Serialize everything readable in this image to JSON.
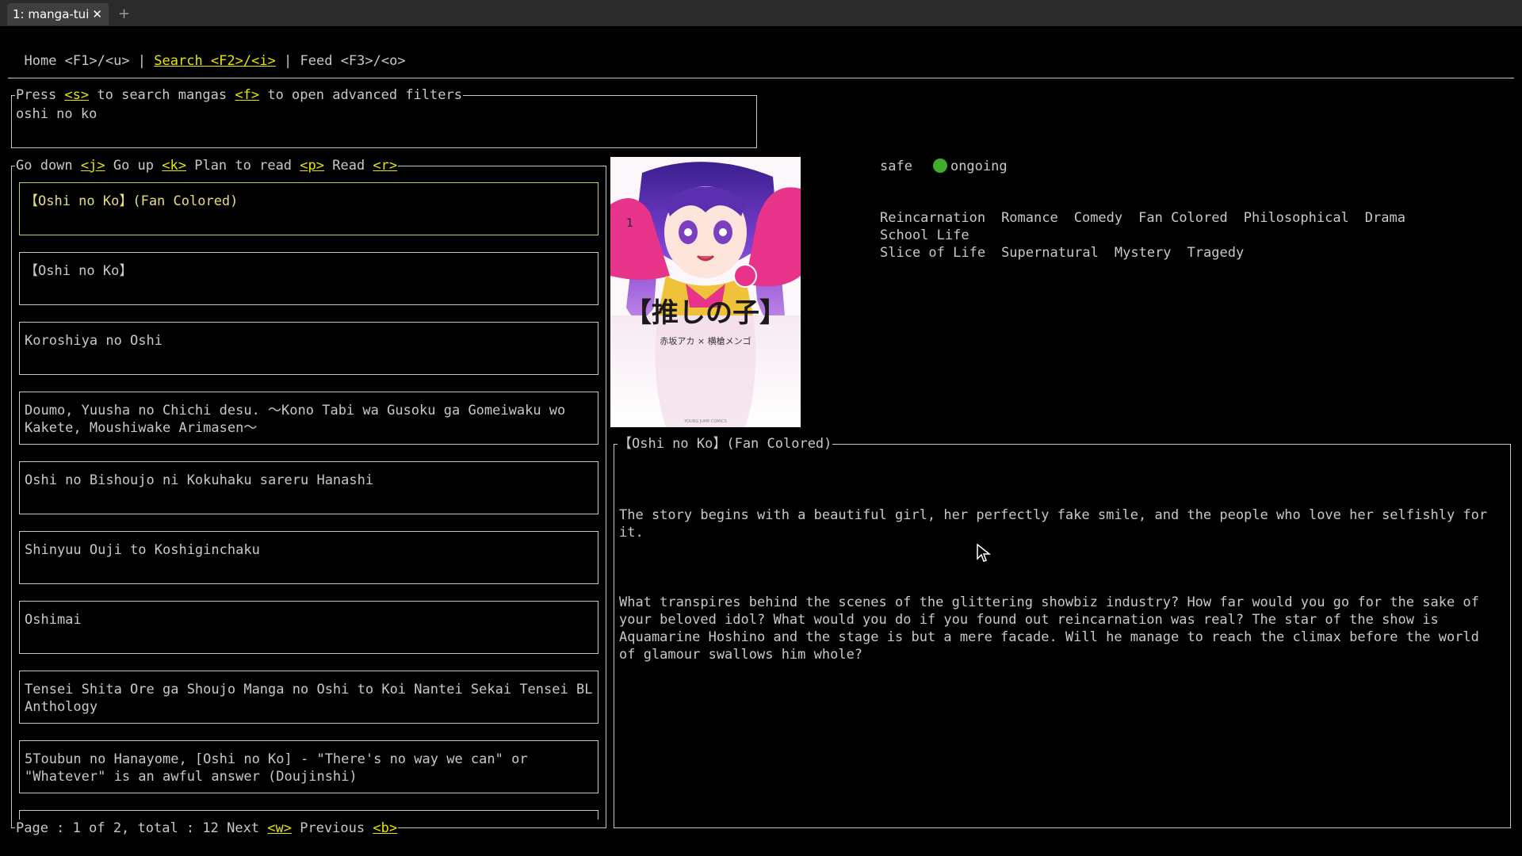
{
  "terminal": {
    "tab_title": "1: manga-tui",
    "close_glyph": "✕",
    "new_tab_glyph": "+"
  },
  "nav": {
    "home": "Home <F1>/<u>",
    "sep1": " | ",
    "search": "Search <F2>/<i>",
    "sep2": " | ",
    "feed": "Feed <F3>/<o>"
  },
  "search": {
    "hint_pre": "Press ",
    "hint_key_s": "<s>",
    "hint_mid": " to search mangas ",
    "hint_key_f": "<f>",
    "hint_post": " to open advanced filters",
    "value": "oshi no ko"
  },
  "list": {
    "help": {
      "down_label": "Go down ",
      "down_key": "<j>",
      "up_label": " Go up ",
      "up_key": "<k>",
      "plan_label": " Plan to read ",
      "plan_key": "<p>",
      "read_label": " Read ",
      "read_key": "<r>"
    },
    "items": [
      "【Oshi no Ko】(Fan Colored)",
      "【Oshi no Ko】",
      "Koroshiya no Oshi",
      "Doumo, Yuusha no Chichi desu. ～Kono Tabi wa Gusoku ga Gomeiwaku wo Kakete, Moushiwake Arimasen～",
      "Oshi no Bishoujo ni Kokuhaku sareru Hanashi",
      "Shinyuu Ouji to Koshiginchaku",
      "Oshimai",
      "Tensei Shita Ore ga Shoujo Manga no Oshi to Koi Nantei Sekai Tensei BL Anthology",
      "5Toubun no Hanayome, [Oshi no Ko] - \"There's no way we can\" or \"Whatever\" is an awful answer (Doujinshi)"
    ],
    "selected_index": 0,
    "pagination": {
      "text": "Page : 1 of 2, total : 12 Next ",
      "next_key": "<w>",
      "prev_label": " Previous ",
      "prev_key": "<b>"
    }
  },
  "details": {
    "content_rating": "safe",
    "status": "ongoing",
    "status_color": "#3fae2b",
    "tags": [
      "Reincarnation",
      "Romance",
      "Comedy",
      "Fan Colored",
      "Philosophical",
      "Drama",
      "School Life",
      "Slice of Life",
      "Supernatural",
      "Mystery",
      "Tragedy"
    ],
    "title": "【Oshi no Ko】(Fan Colored)",
    "description": [
      "The story begins with a beautiful girl, her perfectly fake smile, and the people who love her selfishly for it.",
      "What transpires behind the scenes of the glittering showbiz industry? How far would you go for the sake of your beloved idol? What would you do if you found out reincarnation was real? The star of the show is Aquamarine Hoshino and the stage is but a mere facade. Will he manage to reach the climax before the world of glamour swallows him whole?"
    ],
    "cover": {
      "logo_text": "【推しの子】",
      "authors": "赤坂アカ × 横槍メンゴ",
      "volume": "1",
      "publisher": "YOUNG JUMP COMICS"
    }
  }
}
